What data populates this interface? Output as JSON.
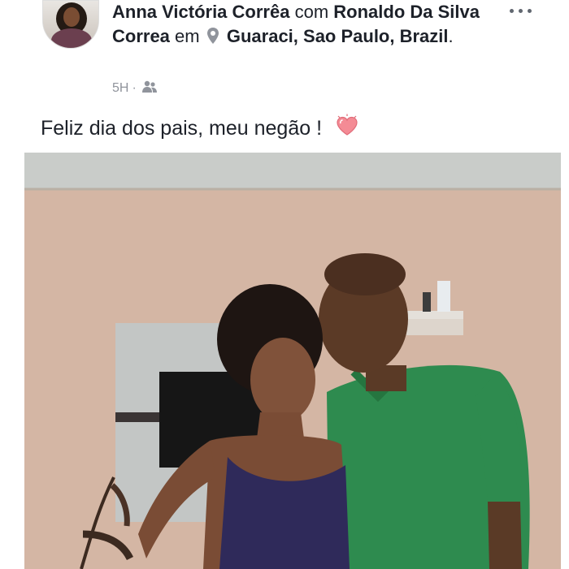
{
  "post": {
    "author": "Anna Victória Corrêa",
    "connector_with": "com",
    "tagged_person": "Ronaldo Da Silva Correa",
    "connector_at": "em",
    "location": "Guaraci, Sao Paulo, Brazil",
    "location_suffix": ".",
    "timestamp": "5H",
    "separator": "·",
    "audience_icon": "friends-icon",
    "message": "Feliz dia dos pais, meu negão !",
    "emoji_icon": "heart-emoji-icon",
    "menu_icon": "more-options-icon"
  },
  "colors": {
    "text": "#1d2129",
    "meta": "#90949c",
    "shirt": "#2e8b4f",
    "wall": "#d4b6a4",
    "heart": "#f48b95"
  }
}
